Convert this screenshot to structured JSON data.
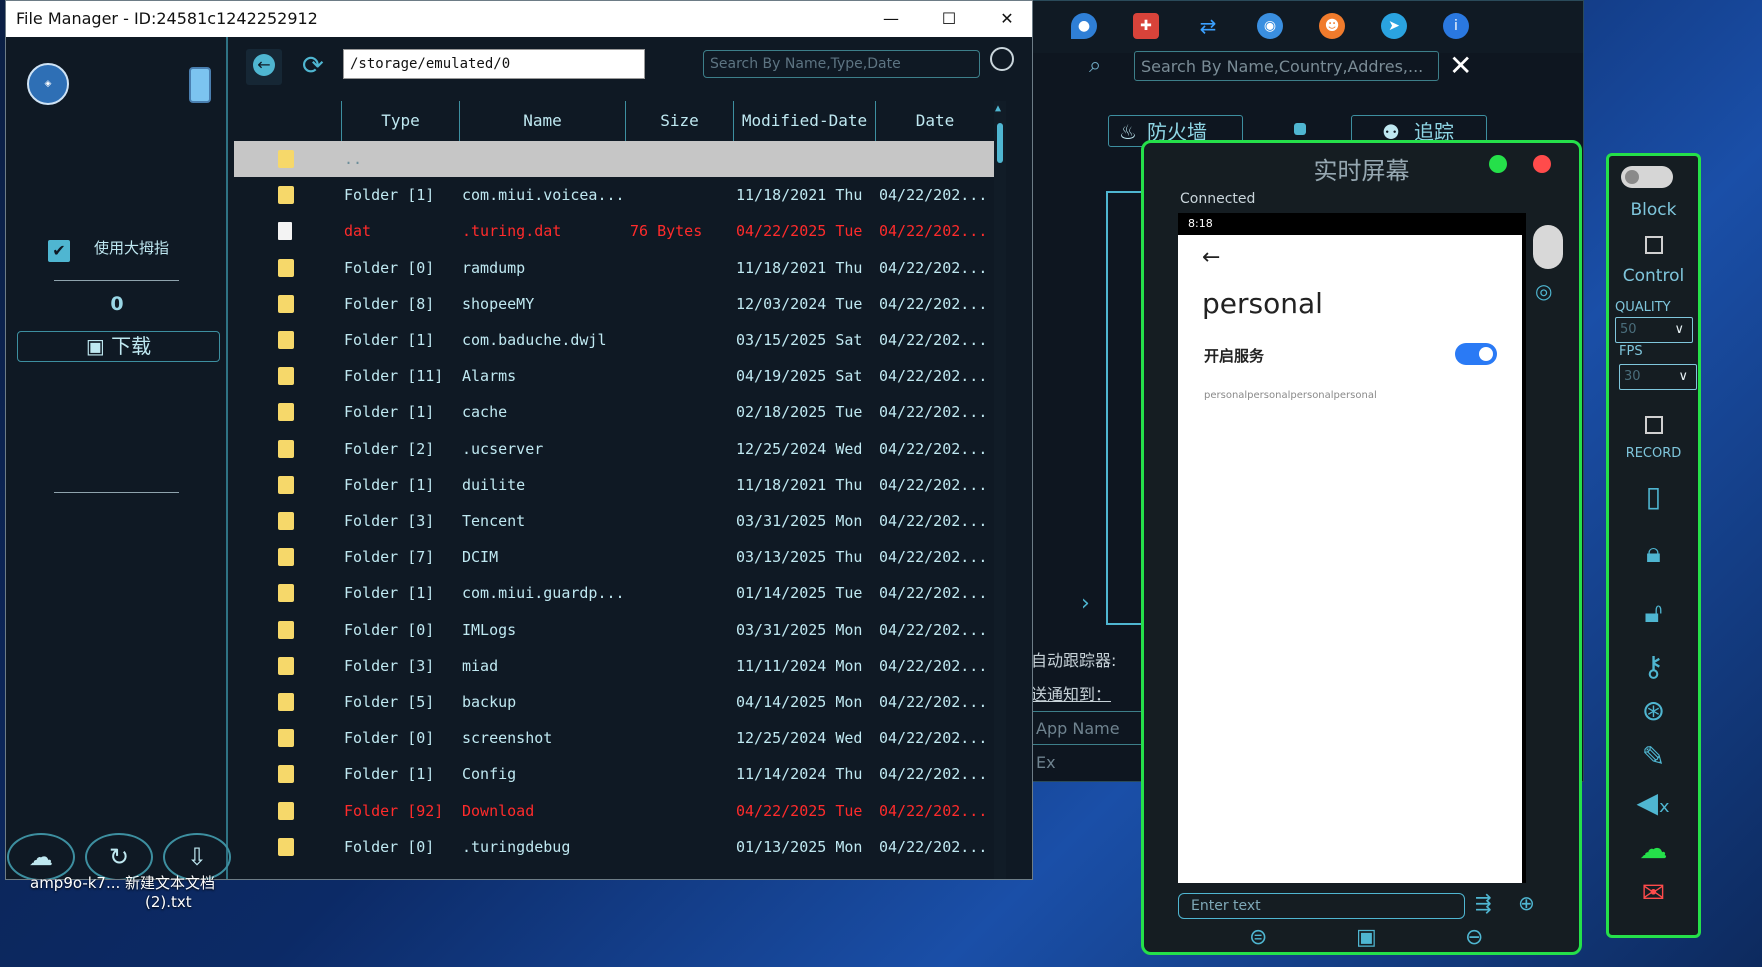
{
  "background_app": {
    "search_placeholder": "Search By Name,Country,Addres,...",
    "close_label": "✕",
    "firewall_label": "防火墙",
    "trace_label": "追踪",
    "auto_tracker_label": "自动跟踪器:",
    "notify_label": "送通知到：",
    "app_name_placeholder": "App Name Ex",
    "expand_label": "›",
    "icons": [
      "location-icon",
      "shield-icon",
      "sync-icon",
      "chrome-icon",
      "fox-icon",
      "telegram-icon",
      "info-icon"
    ]
  },
  "file_manager": {
    "title": "File Manager - ID:24581c1242252912",
    "window_controls": {
      "minimize": "—",
      "maximize": "☐",
      "close": "✕"
    },
    "sidebar": {
      "use_big_thumb_label": "使用大拇指",
      "selected_count": "0",
      "download_label": "下载"
    },
    "toolbar": {
      "path": "/storage/emulated/0",
      "search_placeholder": "Search By Name,Type,Date"
    },
    "columns": [
      "Type",
      "Name",
      "Size",
      "Modified-Date",
      "Date"
    ],
    "rows": [
      {
        "type": "..",
        "name": "",
        "size": "",
        "modified": "",
        "date": "",
        "kind": "parent",
        "style": "selected"
      },
      {
        "type": "Folder [1]",
        "name": "com.miui.voicea...",
        "size": "",
        "modified": "11/18/2021 Thu",
        "date": "04/22/202...",
        "kind": "folder",
        "style": "normal"
      },
      {
        "type": "dat",
        "name": ".turing.dat",
        "size": "76 Bytes",
        "modified": "04/22/2025 Tue",
        "date": "04/22/202...",
        "kind": "file",
        "style": "red"
      },
      {
        "type": "Folder [0]",
        "name": "ramdump",
        "size": "",
        "modified": "11/18/2021 Thu",
        "date": "04/22/202...",
        "kind": "folder",
        "style": "normal"
      },
      {
        "type": "Folder [8]",
        "name": "shopeeMY",
        "size": "",
        "modified": "12/03/2024 Tue",
        "date": "04/22/202...",
        "kind": "folder",
        "style": "normal"
      },
      {
        "type": "Folder [1]",
        "name": "com.baduche.dwjl",
        "size": "",
        "modified": "03/15/2025 Sat",
        "date": "04/22/202...",
        "kind": "folder",
        "style": "normal"
      },
      {
        "type": "Folder [11]",
        "name": "Alarms",
        "size": "",
        "modified": "04/19/2025 Sat",
        "date": "04/22/202...",
        "kind": "folder",
        "style": "normal"
      },
      {
        "type": "Folder [1]",
        "name": "cache",
        "size": "",
        "modified": "02/18/2025 Tue",
        "date": "04/22/202...",
        "kind": "folder",
        "style": "normal"
      },
      {
        "type": "Folder [2]",
        "name": ".ucserver",
        "size": "",
        "modified": "12/25/2024 Wed",
        "date": "04/22/202...",
        "kind": "folder",
        "style": "normal"
      },
      {
        "type": "Folder [1]",
        "name": "duilite",
        "size": "",
        "modified": "11/18/2021 Thu",
        "date": "04/22/202...",
        "kind": "folder",
        "style": "normal"
      },
      {
        "type": "Folder [3]",
        "name": "Tencent",
        "size": "",
        "modified": "03/31/2025 Mon",
        "date": "04/22/202...",
        "kind": "folder",
        "style": "normal"
      },
      {
        "type": "Folder [7]",
        "name": "DCIM",
        "size": "",
        "modified": "03/13/2025 Thu",
        "date": "04/22/202...",
        "kind": "folder",
        "style": "normal"
      },
      {
        "type": "Folder [1]",
        "name": "com.miui.guardp...",
        "size": "",
        "modified": "01/14/2025 Tue",
        "date": "04/22/202...",
        "kind": "folder",
        "style": "normal"
      },
      {
        "type": "Folder [0]",
        "name": "IMLogs",
        "size": "",
        "modified": "03/31/2025 Mon",
        "date": "04/22/202...",
        "kind": "folder",
        "style": "normal"
      },
      {
        "type": "Folder [3]",
        "name": "miad",
        "size": "",
        "modified": "11/11/2024 Mon",
        "date": "04/22/202...",
        "kind": "folder",
        "style": "normal"
      },
      {
        "type": "Folder [5]",
        "name": "backup",
        "size": "",
        "modified": "04/14/2025 Mon",
        "date": "04/22/202...",
        "kind": "folder",
        "style": "normal"
      },
      {
        "type": "Folder [0]",
        "name": "screenshot",
        "size": "",
        "modified": "12/25/2024 Wed",
        "date": "04/22/202...",
        "kind": "folder",
        "style": "normal"
      },
      {
        "type": "Folder [1]",
        "name": "Config",
        "size": "",
        "modified": "11/14/2024 Thu",
        "date": "04/22/202...",
        "kind": "folder",
        "style": "normal"
      },
      {
        "type": "Folder [92]",
        "name": "Download",
        "size": "",
        "modified": "04/22/2025 Tue",
        "date": "04/22/202...",
        "kind": "folder",
        "style": "red"
      },
      {
        "type": "Folder [0]",
        "name": ".turingdebug",
        "size": "",
        "modified": "01/13/2025 Mon",
        "date": "04/22/202...",
        "kind": "folder",
        "style": "normal"
      }
    ]
  },
  "live_screen": {
    "title": "实时屏幕",
    "status": "Connected",
    "phone": {
      "time": "8:18",
      "back": "←",
      "page_title": "personal",
      "service_label": "开启服务",
      "service_on": true,
      "small_text": "personalpersonalpersonalpersonal"
    },
    "enter_text_placeholder": "Enter text"
  },
  "control_panel": {
    "block_label": "Block",
    "control_label": "Control",
    "quality_label": "QUALITY",
    "quality_value": "50",
    "fps_label": "FPS",
    "fps_value": "30",
    "record_label": "RECORD"
  },
  "desktop": {
    "icon_label_1": "amp9o-k7...  新建文本文档",
    "icon_label_2": "(2).txt"
  },
  "colors": {
    "accent": "#4fb6d1",
    "green_frame": "#25e04a",
    "red_text": "#ff2b2b"
  }
}
